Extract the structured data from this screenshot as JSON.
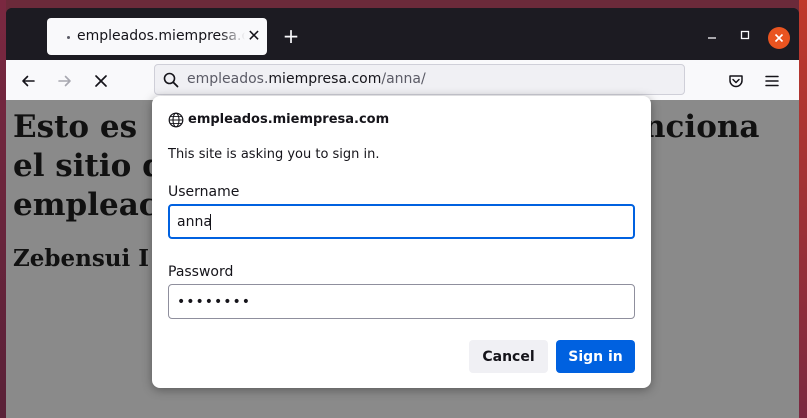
{
  "tab": {
    "title": "empleados.miempresa.com",
    "close_glyph": "✕"
  },
  "toolbar": {
    "new_tab_glyph": "+",
    "url_prefix": "empleados.",
    "url_domain": "miempresa.com",
    "url_path": "/anna/"
  },
  "page": {
    "heading": "Esto es el sitio de empleados de Zebensui. Funciona el sitio de empleados...",
    "heading_visible_left": "Esto es",
    "heading_visible_right": "nciona",
    "heading_line2_left": "el sitio d",
    "heading_line3_left": "empleac",
    "subheading_left": "Zebensui I"
  },
  "dialog": {
    "host": "empleados.miempresa.com",
    "message": "This site is asking you to sign in.",
    "username_label": "Username",
    "username_value": "anna",
    "password_label": "Password",
    "password_value": "••••••••",
    "cancel_label": "Cancel",
    "signin_label": "Sign in"
  },
  "colors": {
    "accent": "#0061e0",
    "close_button": "#e95420"
  },
  "icons": [
    "back-arrow-icon",
    "forward-arrow-icon",
    "stop-icon",
    "search-icon",
    "pocket-icon",
    "menu-icon",
    "globe-icon",
    "minimize-icon",
    "maximize-icon",
    "close-icon"
  ]
}
